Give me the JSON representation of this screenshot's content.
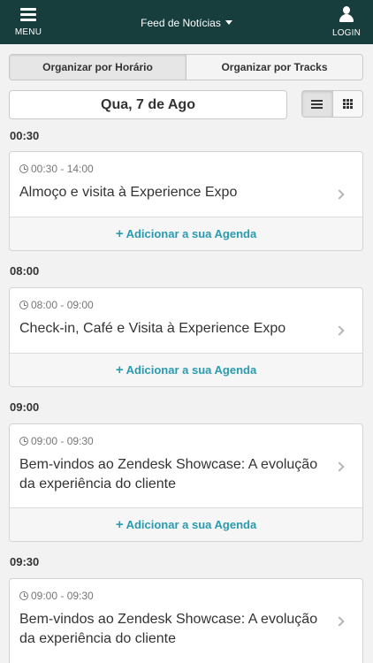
{
  "topbar": {
    "menu_label": "MENU",
    "feed_label": "Feed de Notícias",
    "login_label": "LOGIN",
    "menu_icon": "hamburger-icon",
    "login_icon": "user-icon",
    "background": "#173d3d"
  },
  "tabs": [
    {
      "label": "Organizar por Horário",
      "active": true
    },
    {
      "label": "Organizar por Tracks",
      "active": false
    }
  ],
  "date": {
    "label": "Qua, 7 de Ago",
    "views": [
      {
        "icon": "list-view-icon",
        "active": true
      },
      {
        "icon": "grid-view-icon",
        "active": false
      }
    ]
  },
  "schedule": [
    {
      "time_header": "00:30",
      "time_range": "00:30 - 14:00",
      "title": "Almoço e visita à Experience Expo",
      "action": "Adicionar a sua Agenda"
    },
    {
      "time_header": "08:00",
      "time_range": "08:00 - 09:00",
      "title": "Check-in, Café e Visita à Experience Expo",
      "action": "Adicionar a sua Agenda"
    },
    {
      "time_header": "09:00",
      "time_range": "09:00 - 09:30",
      "title": "Bem-vindos ao Zendesk Showcase: A evolução da experiência do cliente",
      "action": "Adicionar a sua Agenda"
    },
    {
      "time_header": "09:30",
      "time_range": "09:00 - 09:30",
      "title": "Bem-vindos ao Zendesk Showcase: A evolução da experiência do cliente",
      "action": ""
    }
  ],
  "colors": {
    "accent": "#2a9bb0",
    "header_bg": "#173d3d",
    "page_bg": "#f2f2f2"
  }
}
